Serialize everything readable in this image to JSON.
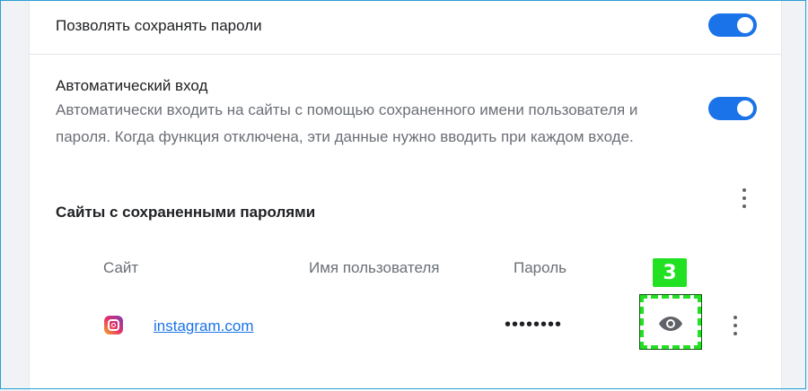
{
  "settings": {
    "save_passwords_label": "Позволять сохранять пароли",
    "save_passwords_enabled": true,
    "auto_signin_label": "Автоматический вход",
    "auto_signin_desc_line1": "Автоматически входить на сайты с помощью сохраненного имени пользователя и",
    "auto_signin_desc_line2": "пароля. Когда функция отключена, эти данные нужно вводить при каждом входе.",
    "auto_signin_enabled": true
  },
  "saved_passwords": {
    "title": "Сайты с сохраненными паролями",
    "columns": {
      "site": "Сайт",
      "username": "Имя пользователя",
      "password": "Пароль"
    },
    "rows": [
      {
        "icon": "instagram-icon",
        "site": "instagram.com",
        "username": "",
        "password_masked": "••••••••"
      }
    ]
  },
  "annotation": {
    "step_number": "3",
    "highlight_color": "#22e022"
  },
  "colors": {
    "accent": "#1a73e8",
    "text": "#202124",
    "muted": "#6b6f76"
  }
}
